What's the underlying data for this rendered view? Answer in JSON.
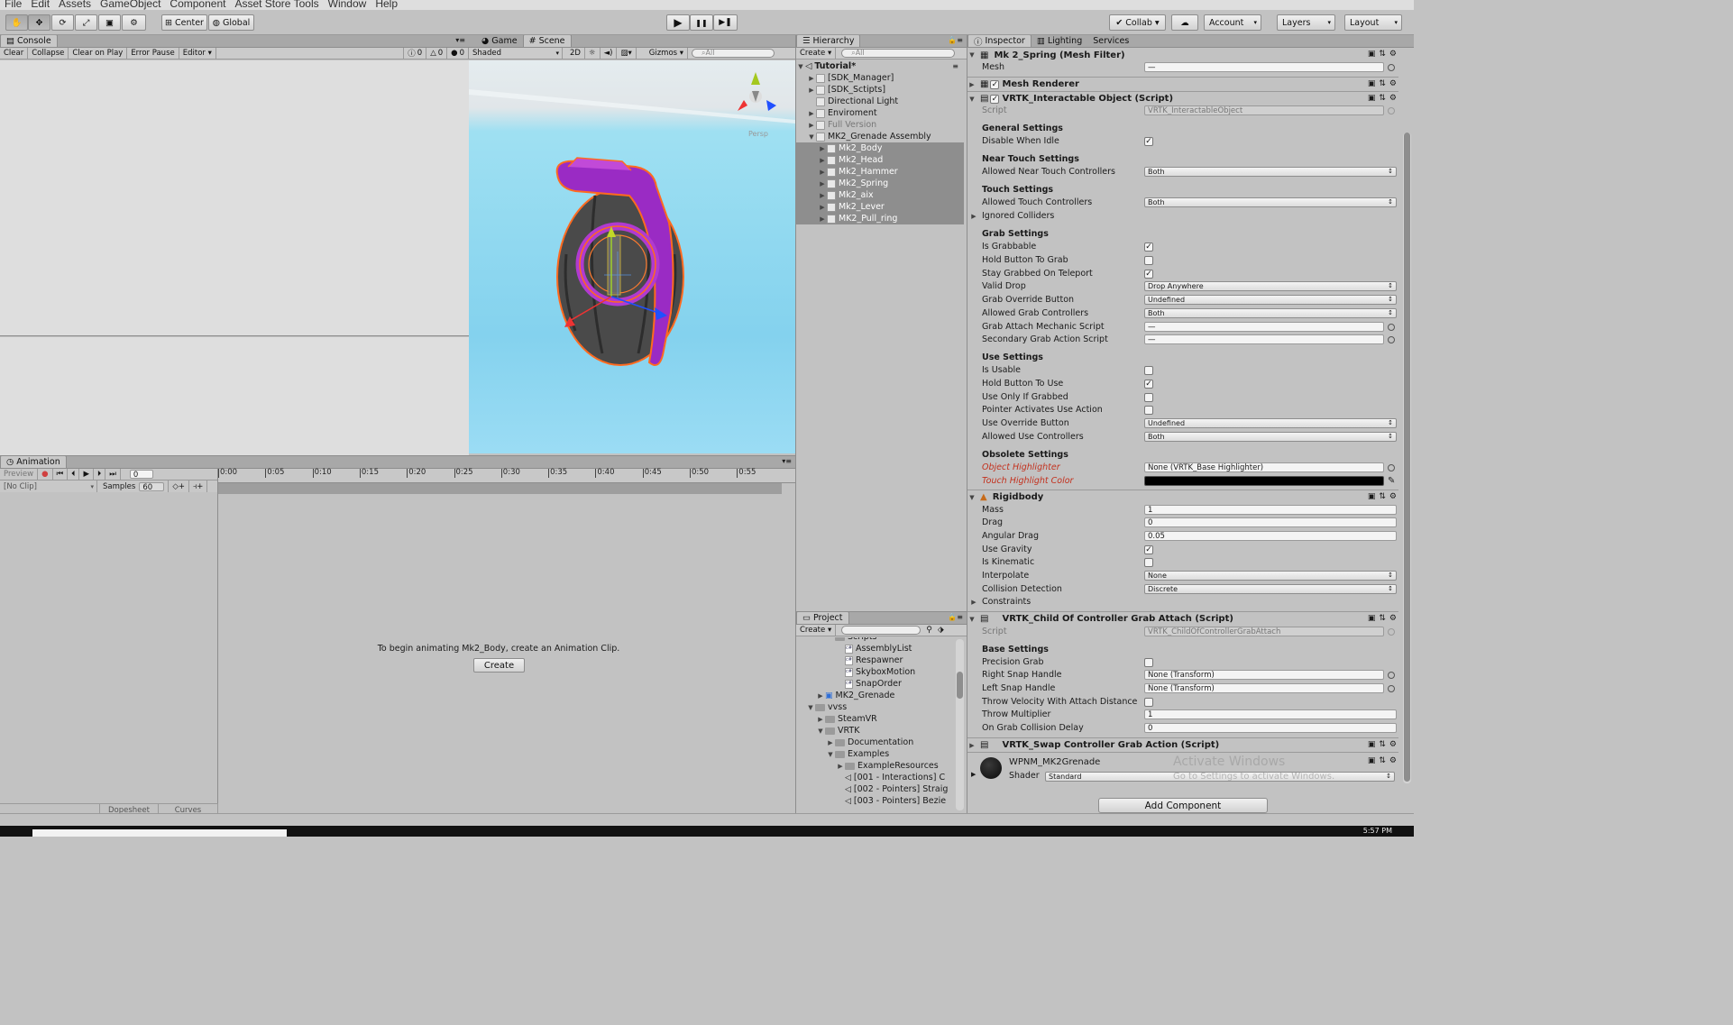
{
  "menu": [
    "File",
    "Edit",
    "Assets",
    "GameObject",
    "Component",
    "Asset Store Tools",
    "Window",
    "Help"
  ],
  "toolbar": {
    "tools": [
      "hand-icon",
      "move-icon",
      "rotate-icon",
      "scale-icon",
      "rect-icon",
      "transform-icon"
    ],
    "center_label": "Center",
    "global_label": "Global",
    "play_icon": "▶",
    "pause_icon": "❚❚",
    "step_icon": "▶❚",
    "collab_label": "Collab ▾",
    "account_label": "Account",
    "layers_label": "Layers",
    "layout_label": "Layout"
  },
  "console": {
    "tab": "Console",
    "buttons": [
      "Clear",
      "Collapse",
      "Clear on Play",
      "Error Pause",
      "Editor ▾"
    ],
    "info_count": "0",
    "warn_count": "0",
    "error_count": "0"
  },
  "scene": {
    "tab_game": "Game",
    "tab_scene": "Scene",
    "shaded": "Shaded",
    "mode2d": "2D",
    "gizmos": "Gizmos ▾",
    "search_placeholder": "⌕All",
    "persp": "Persp"
  },
  "hierarchy": {
    "tab": "Hierarchy",
    "create": "Create ▾",
    "search_placeholder": "⌕All",
    "scene_name": "Tutorial*",
    "items": [
      {
        "label": "[SDK_Manager]",
        "indent": 1,
        "arrow": "▶",
        "sel": false
      },
      {
        "label": "[SDK_Sctipts]",
        "indent": 1,
        "arrow": "▶",
        "sel": false
      },
      {
        "label": "Directional Light",
        "indent": 1,
        "arrow": "",
        "sel": false
      },
      {
        "label": "Enviroment",
        "indent": 1,
        "arrow": "▶",
        "sel": false
      },
      {
        "label": "Full Version",
        "indent": 1,
        "arrow": "▶",
        "sel": false,
        "dim": true
      },
      {
        "label": "MK2_Grenade Assembly",
        "indent": 1,
        "arrow": "▼",
        "sel": false
      },
      {
        "label": "Mk2_Body",
        "indent": 2,
        "arrow": "▶",
        "sel": true
      },
      {
        "label": "Mk2_Head",
        "indent": 2,
        "arrow": "▶",
        "sel": true
      },
      {
        "label": "Mk2_Hammer",
        "indent": 2,
        "arrow": "▶",
        "sel": true
      },
      {
        "label": "Mk2_Spring",
        "indent": 2,
        "arrow": "▶",
        "sel": true
      },
      {
        "label": "Mk2_aix",
        "indent": 2,
        "arrow": "▶",
        "sel": true
      },
      {
        "label": "Mk2_Lever",
        "indent": 2,
        "arrow": "▶",
        "sel": true
      },
      {
        "label": "MK2_Pull_ring",
        "indent": 2,
        "arrow": "▶",
        "sel": true
      }
    ]
  },
  "project": {
    "tab": "Project",
    "create": "Create ▾",
    "items": [
      {
        "label": "Scripts",
        "indent": 3,
        "kind": "folder"
      },
      {
        "label": "AssemblyList",
        "indent": 4,
        "kind": "cs"
      },
      {
        "label": "Respawner",
        "indent": 4,
        "kind": "cs"
      },
      {
        "label": "SkyboxMotion",
        "indent": 4,
        "kind": "cs"
      },
      {
        "label": "SnapOrder",
        "indent": 4,
        "kind": "cs"
      },
      {
        "label": "MK2_Grenade",
        "indent": 2,
        "kind": "prefab",
        "arrow": "▶"
      },
      {
        "label": "vvss",
        "indent": 1,
        "kind": "folder",
        "arrow": "▼"
      },
      {
        "label": "SteamVR",
        "indent": 2,
        "kind": "folder",
        "arrow": "▶"
      },
      {
        "label": "VRTK",
        "indent": 2,
        "kind": "folder",
        "arrow": "▼"
      },
      {
        "label": "Documentation",
        "indent": 3,
        "kind": "folder",
        "arrow": "▶"
      },
      {
        "label": "Examples",
        "indent": 3,
        "kind": "folder",
        "arrow": "▼"
      },
      {
        "label": "ExampleResources",
        "indent": 4,
        "kind": "folder",
        "arrow": "▶"
      },
      {
        "label": "[001 - Interactions] C",
        "indent": 4,
        "kind": "unity"
      },
      {
        "label": "[002 - Pointers] Straig",
        "indent": 4,
        "kind": "unity"
      },
      {
        "label": "[003 - Pointers] Bezie",
        "indent": 4,
        "kind": "unity"
      }
    ]
  },
  "animation": {
    "tab": "Animation",
    "preview": "Preview",
    "frame": "0",
    "no_clip": "[No Clip]",
    "samples_label": "Samples",
    "samples_value": "60",
    "ticks": [
      "0:00",
      "0:05",
      "0:10",
      "0:15",
      "0:20",
      "0:25",
      "0:30",
      "0:35",
      "0:40",
      "0:45",
      "0:50",
      "0:55"
    ],
    "message": "To begin animating Mk2_Body, create an Animation Clip.",
    "create_button": "Create",
    "dopesheet": "Dopesheet",
    "curves": "Curves"
  },
  "inspector": {
    "tab": "Inspector",
    "tab_lighting": "Lighting",
    "tab_services": "Services",
    "mesh_filter": {
      "title": "Mk 2_Spring (Mesh Filter)",
      "mesh_label": "Mesh",
      "mesh_value": "—"
    },
    "mesh_renderer": "Mesh Renderer",
    "interactable": {
      "title": "VRTK_Interactable Object (Script)",
      "script_label": "Script",
      "script_value": "VRTK_InteractableObject",
      "general": "General Settings",
      "disable_idle": "Disable When Idle",
      "near": "Near Touch Settings",
      "near_ctrl": "Allowed Near Touch Controllers",
      "near_ctrl_value": "Both",
      "touch": "Touch Settings",
      "touch_ctrl": "Allowed Touch Controllers",
      "touch_ctrl_value": "Both",
      "ignored": "Ignored Colliders",
      "grab": "Grab Settings",
      "is_grabbable": "Is Grabbable",
      "hold_grab": "Hold Button To Grab",
      "stay_grabbed": "Stay Grabbed On Teleport",
      "valid_drop": "Valid Drop",
      "valid_drop_value": "Drop Anywhere",
      "grab_override": "Grab Override Button",
      "grab_override_value": "Undefined",
      "grab_ctrl": "Allowed Grab Controllers",
      "grab_ctrl_value": "Both",
      "grab_attach": "Grab Attach Mechanic Script",
      "grab_attach_value": "—",
      "secondary": "Secondary Grab Action Script",
      "secondary_value": "—",
      "use": "Use Settings",
      "is_usable": "Is Usable",
      "hold_use": "Hold Button To Use",
      "use_only": "Use Only If Grabbed",
      "pointer": "Pointer Activates Use Action",
      "use_override": "Use Override Button",
      "use_override_value": "Undefined",
      "use_ctrl": "Allowed Use Controllers",
      "use_ctrl_value": "Both",
      "obsolete": "Obsolete Settings",
      "obj_highlighter": "Object Highlighter",
      "obj_highlighter_value": "None (VRTK_Base Highlighter)",
      "touch_color": "Touch Highlight Color"
    },
    "rigidbody": {
      "title": "Rigidbody",
      "mass": "Mass",
      "mass_value": "1",
      "drag": "Drag",
      "drag_value": "0",
      "ang": "Angular Drag",
      "ang_value": "0.05",
      "gravity": "Use Gravity",
      "kinematic": "Is Kinematic",
      "interp": "Interpolate",
      "interp_value": "None",
      "collision": "Collision Detection",
      "collision_value": "Discrete",
      "constraints": "Constraints"
    },
    "child_grab": {
      "title": "VRTK_Child Of Controller Grab Attach (Script)",
      "script_label": "Script",
      "script_value": "VRTK_ChildOfControllerGrabAttach",
      "base": "Base Settings",
      "precision": "Precision Grab",
      "right": "Right Snap Handle",
      "right_value": "None (Transform)",
      "left": "Left Snap Handle",
      "left_value": "None (Transform)",
      "throw_vel": "Throw Velocity With Attach Distance",
      "throw_mult": "Throw Multiplier",
      "throw_mult_value": "1",
      "delay": "On Grab Collision Delay",
      "delay_value": "0"
    },
    "swap": "VRTK_Swap Controller Grab Action (Script)",
    "material": {
      "name": "WPNM_MK2Grenade",
      "shader_label": "Shader",
      "shader_value": "Standard"
    },
    "add_component": "Add Component",
    "activate_title": "Activate Windows",
    "activate_sub": "Go to Settings to activate Windows."
  },
  "taskbar_time": "5:57 PM"
}
